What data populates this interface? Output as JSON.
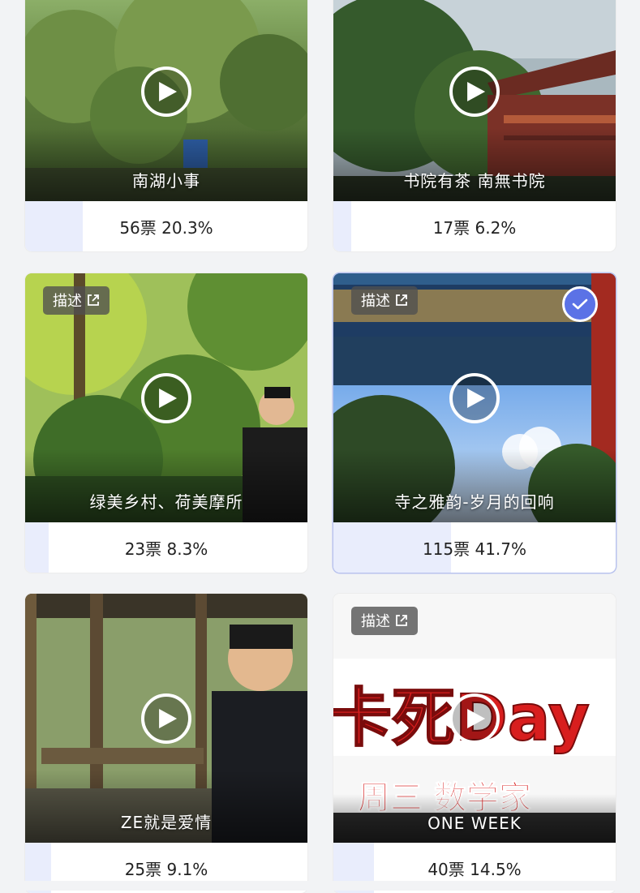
{
  "colors": {
    "page_bg": "#f2f3f5",
    "accent": "#5b72e6",
    "vote_fill": "#e9edfc"
  },
  "icons": {
    "play": "play-icon",
    "description_link": "external-link-icon",
    "selected_check": "check-icon"
  },
  "cards": [
    {
      "caption": "南湖小事",
      "votes": "56票 20.3%",
      "has_desc": false,
      "selected": false
    },
    {
      "caption": "书院有茶 南無书院",
      "votes": "17票 6.2%",
      "has_desc": false,
      "selected": false
    },
    {
      "caption": "绿美乡村、荷美摩所",
      "votes": "23票 8.3%",
      "has_desc": true,
      "desc_label": "描述",
      "selected": false
    },
    {
      "caption": "寺之雅韵-岁月的回响",
      "votes": "115票 41.7%",
      "has_desc": true,
      "desc_label": "描述",
      "selected": true
    },
    {
      "caption": "ZE就是爱情",
      "votes": "25票 9.1%",
      "has_desc": false,
      "selected": false
    },
    {
      "caption": "ONE WEEK",
      "votes": "40票 14.5%",
      "has_desc": true,
      "desc_label": "描述",
      "selected": false,
      "poster_text_1": "卡死Day",
      "poster_text_2": "周三 数学家"
    }
  ]
}
